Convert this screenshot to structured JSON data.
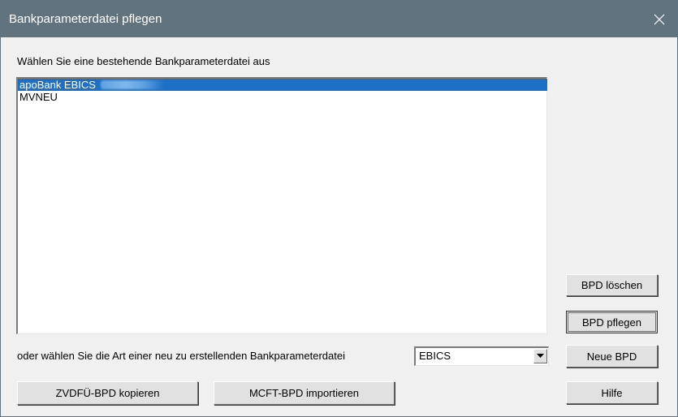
{
  "window": {
    "title": "Bankparameterdatei pflegen",
    "close_icon": "close-icon"
  },
  "list": {
    "label": "Wählen Sie eine bestehende Bankparameterdatei aus",
    "items": [
      {
        "label": "apoBank EBICS",
        "selected": true
      },
      {
        "label": "MVNEU",
        "selected": false
      }
    ]
  },
  "new_file": {
    "label": "oder wählen Sie die Art einer neu zu erstellenden Bankparameterdatei",
    "selected_type": "EBICS"
  },
  "buttons": {
    "delete": "BPD löschen",
    "edit": "BPD pflegen",
    "new": "Neue BPD",
    "copy_zvdfue": "ZVDFÜ-BPD kopieren",
    "import_mcft": "MCFT-BPD importieren",
    "help": "Hilfe"
  },
  "colors": {
    "titlebar": "#61737f",
    "selection": "#1e70c6",
    "background": "#f0f0f0"
  }
}
